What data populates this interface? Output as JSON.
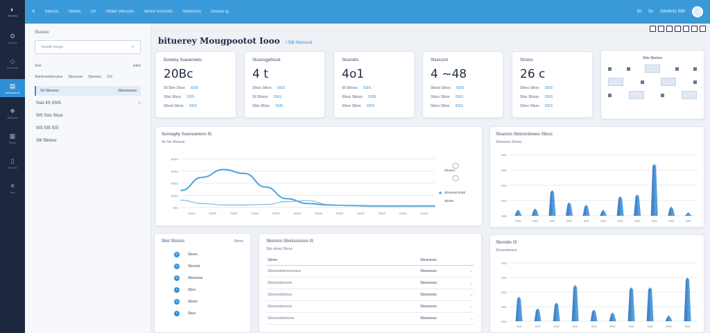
{
  "app": {
    "name": "bituerey"
  },
  "rail": {
    "items": [
      {
        "icon": "gear-icon",
        "label": "Dsnbrd"
      },
      {
        "icon": "cube-icon",
        "label": "Products"
      },
      {
        "icon": "chart-icon",
        "label": "Dashboards"
      },
      {
        "icon": "layers-icon",
        "label": "Modules"
      },
      {
        "icon": "grid-icon",
        "label": "Suites"
      },
      {
        "icon": "tablet-icon",
        "label": "Devices"
      },
      {
        "icon": "wrench-icon",
        "label": "Sett"
      }
    ],
    "active_index": 2
  },
  "topbar": {
    "nav": [
      "Ill",
      "Sleurus",
      "Sfleibs",
      "Srl",
      "Sfflleb Sfleusbs",
      "Sbnlis Sisinisbs",
      "Sleplinsss",
      "Sisoius ig"
    ],
    "right": [
      "Sll",
      "Ss",
      "Stlinllinlo Slllli"
    ]
  },
  "left_panel": {
    "title": "Slureso",
    "search_placeholder": "Skatsbl bscgsr",
    "section_label": "Ssis",
    "section_action": "sdsis",
    "filters": [
      "Slanlesselsinsslss",
      "Sbsnsser",
      "Sbsnsss",
      "SIS"
    ],
    "selected": {
      "label": "Sb Sbnsess",
      "meta": "Sbnssssses"
    },
    "items": [
      {
        "label": "Ssio IIS SSIS",
        "meta": "<"
      },
      {
        "label": "SIS Ssls Slsss",
        "meta": ""
      },
      {
        "label": "SIS SIS SIS",
        "meta": ""
      },
      {
        "label": "Sitl Sbnsss",
        "meta": ""
      }
    ]
  },
  "main": {
    "title": "bituerey Mougpootot Iooo",
    "subtitle": "/ Sllll Sbsnsssl"
  },
  "kpis": [
    {
      "label": "Dunelsy Suasennels",
      "value": "20Bc",
      "rows": [
        [
          "Sll Sbio Sloss",
          "SSIS"
        ],
        [
          "Sllss Sllsss",
          "SSIS"
        ],
        [
          "Sllsssl Sllsss",
          "SSIS"
        ]
      ]
    },
    {
      "label": "Sluusngprbsod",
      "value": "4 t",
      "rows": [
        [
          "Sllsss Sllsss",
          "SSIS"
        ],
        [
          "Sll Sllssss",
          "SSIS"
        ],
        [
          "Sllss Sllsss",
          "SSIS"
        ]
      ]
    },
    {
      "label": "Slusnsbs",
      "value": "4o1",
      "rows": [
        [
          "Sll Sllssss",
          "SSIS"
        ],
        [
          "Sllsss Sllssss",
          "SSIS"
        ],
        [
          "Sllsss Sllsss",
          "SSIS"
        ]
      ]
    },
    {
      "label": "Slsessssl",
      "value": "4 ~48",
      "rows": [
        [
          "Sllsssl Sllsss",
          "SSIS"
        ],
        [
          "Sllsss Sllsss",
          "SSIS"
        ],
        [
          "Sllsss Sllsss",
          "SSIS"
        ]
      ]
    },
    {
      "label": "Slsslss",
      "value": "26 c",
      "rows": [
        [
          "Sllsss Sllsss",
          "SSIS"
        ],
        [
          "Sllss Sllssss",
          "SSIS"
        ],
        [
          "Sllsss Sllsss",
          "SSIS"
        ]
      ]
    }
  ],
  "mini_card": {
    "title": "Sbls Sbslsss"
  },
  "line_chart_card": {
    "title": "Sunnaghy Susnssenons IS",
    "subtitle": "Sb Sls Sbnsssl",
    "legend": [
      "Sbnsss",
      "Sbnssssl Sbssl",
      "Sbslss"
    ]
  },
  "bar_chart_card_1": {
    "title": "Slsasnss Sbsnsssbsess Sbsss",
    "subtitle": "Sbsessss Slsass"
  },
  "bar_chart_card_2": {
    "title": "Sbsnsbs IS",
    "subtitle": "Slsessbsesss"
  },
  "list_card": {
    "title": "Sbsl Sbsnss",
    "action": "Sbnss",
    "items": [
      "Sbsns",
      "Sbsnssl",
      "Sbsnssss",
      "Sbss",
      "Sbsns",
      "Sbss"
    ]
  },
  "table_card": {
    "title": "Sbsnsns Sbslsssnssss IS",
    "subtitle": "Sbs sbsss Sbnss",
    "columns": [
      "Sbnss",
      "Sbnssssss"
    ],
    "rows": [
      [
        "Sbsnsssbslsssnsssss",
        "Sbsnsssss"
      ],
      [
        "Sbsnssslsnssss",
        "Sbsnsssss"
      ],
      [
        "Sbsnsssbslssss",
        "Sbsnsssss"
      ],
      [
        "Sbsnssslsnssss",
        "Sbsnsssss"
      ],
      [
        "Sbsnsssbslsssns",
        "Sbsnsssss"
      ]
    ]
  },
  "chart_data": [
    {
      "type": "line",
      "title": "Sunnaghy Susnssenons IS",
      "ylabel": "",
      "y_tick_labels": [
        "SSSS",
        "SSSS",
        "SSSS",
        "SSSS",
        "SSS"
      ],
      "x_tick_labels": [
        "SSSS",
        "SSSS",
        "SSSS",
        "SSSS",
        "SSSS",
        "SSSS",
        "SSSS",
        "SSSS",
        "SSSS",
        "SSSS",
        "SSSS",
        "SSSS"
      ],
      "ylim": [
        0,
        100
      ],
      "x": [
        0,
        1,
        2,
        3,
        4,
        5,
        6,
        7,
        8,
        9,
        10,
        11,
        12
      ],
      "series": [
        {
          "values": [
            35,
            62,
            78,
            70,
            42,
            18,
            8,
            5,
            4,
            3,
            3,
            3,
            3
          ]
        },
        {
          "values": [
            15,
            8,
            5,
            5,
            6,
            12,
            14,
            6,
            3,
            2,
            2,
            2,
            2
          ]
        }
      ]
    },
    {
      "type": "bar",
      "title": "Slsasnss Sbsnsssbsess Sbsss",
      "y_tick_labels": [
        "SSS",
        "SSS",
        "SSS",
        "SSS",
        "SSS"
      ],
      "x_tick_labels": [
        "SSS",
        "SSS",
        "SSS",
        "SSS",
        "SSS",
        "SSS",
        "SSS",
        "SSS",
        "SSS",
        "SSS",
        "SSS"
      ],
      "ylim": [
        0,
        100
      ],
      "values": [
        10,
        12,
        42,
        22,
        18,
        10,
        32,
        35,
        85,
        15,
        6
      ]
    },
    {
      "type": "bar",
      "title": "Sbsnsbs IS",
      "y_tick_labels": [
        "SSS",
        "SSS",
        "SSS",
        "SSS",
        "SSS"
      ],
      "x_tick_labels": [
        "SSS",
        "SSS",
        "SSS",
        "SSS",
        "SSS",
        "SSS",
        "SSS",
        "SSS",
        "SSS",
        "SSS"
      ],
      "ylim": [
        0,
        100
      ],
      "values": [
        42,
        22,
        32,
        62,
        20,
        15,
        58,
        58,
        10,
        75
      ]
    }
  ],
  "colors": {
    "accent": "#3a9ad9",
    "rail": "#1e2740",
    "series_primary": "#4aa3dc",
    "series_secondary": "#7fb8e0",
    "bar": "#2f78c4"
  }
}
